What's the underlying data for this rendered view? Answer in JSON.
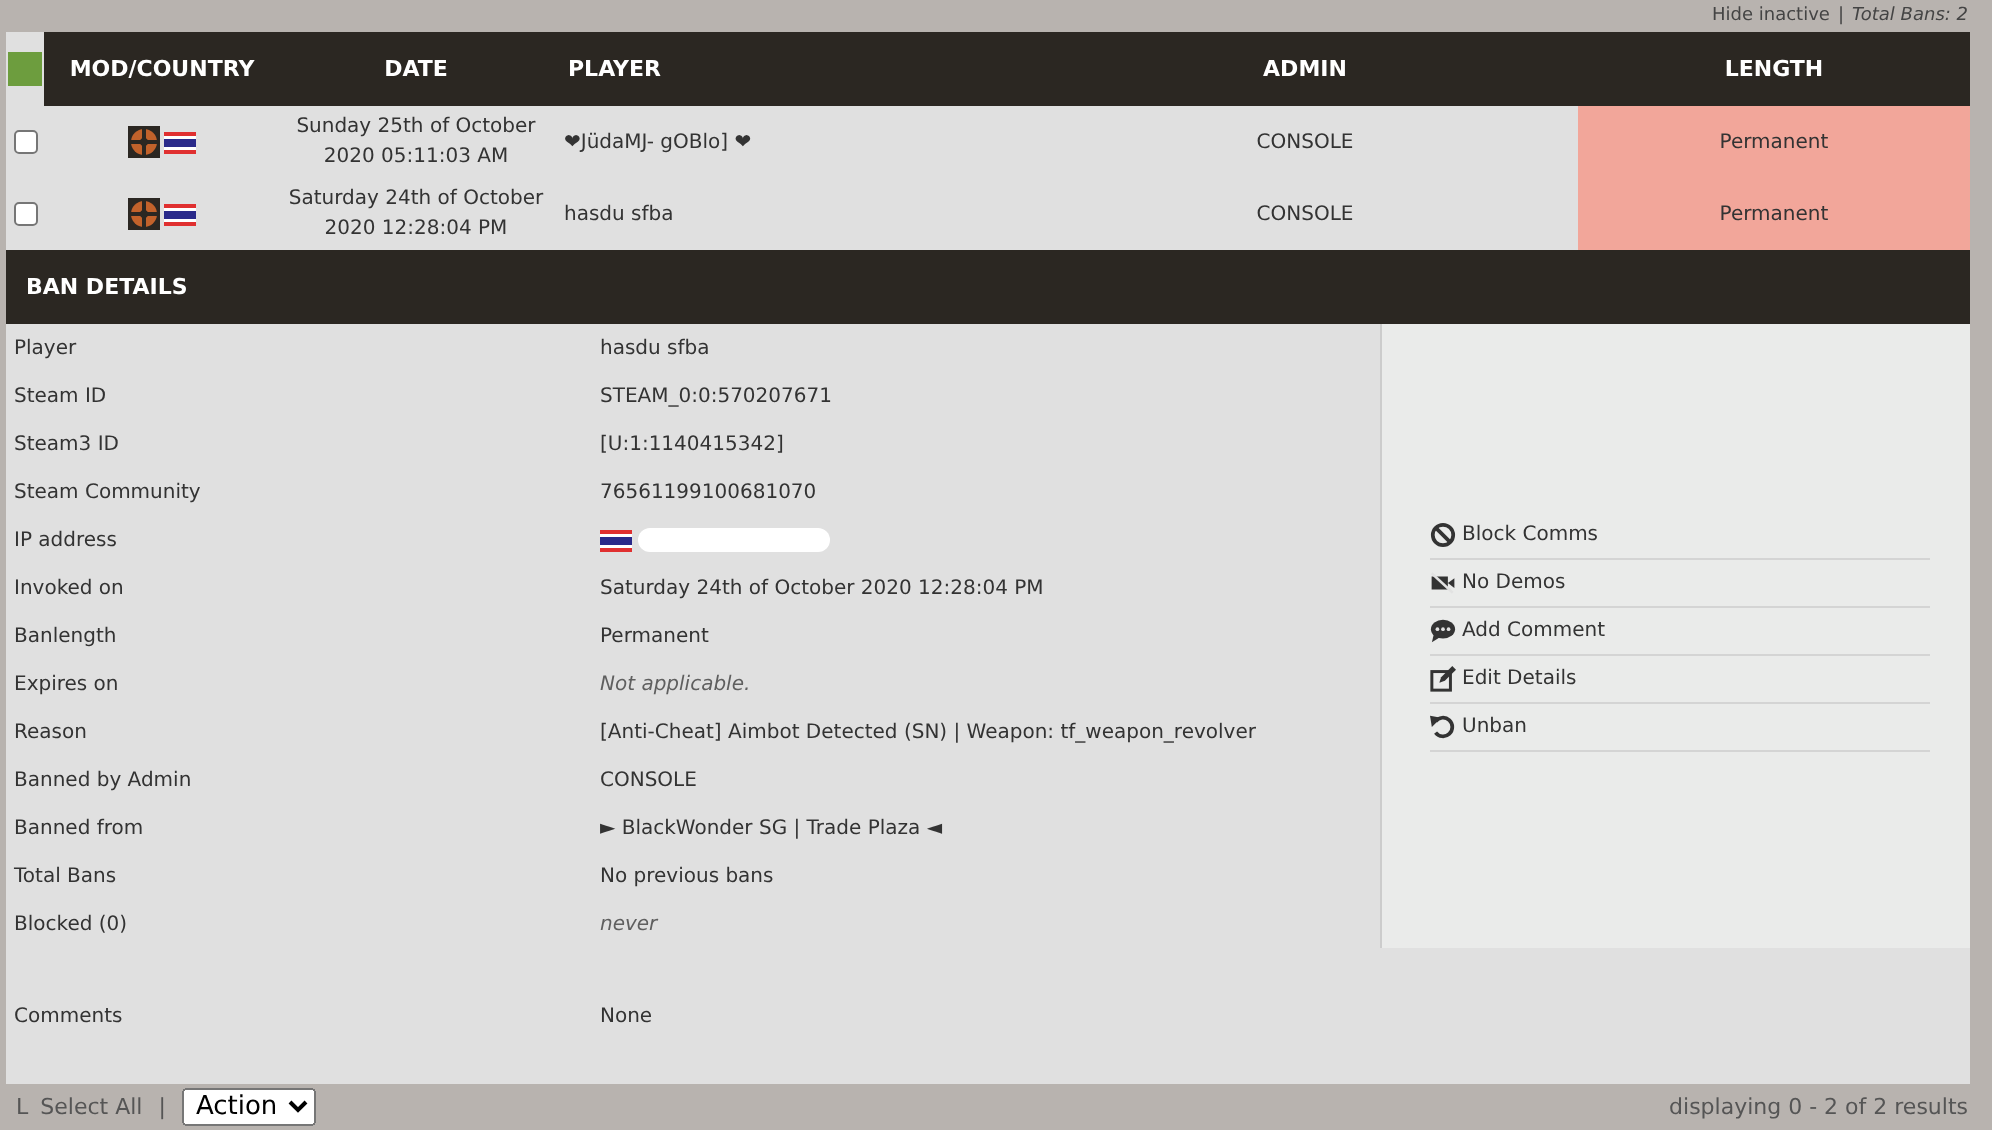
{
  "top_bar": {
    "hide_link": "Hide inactive",
    "separator": "|",
    "total": "Total Bans: 2"
  },
  "table": {
    "columns": [
      "MOD/COUNTRY",
      "DATE",
      "PLAYER",
      "ADMIN",
      "LENGTH"
    ],
    "rows": [
      {
        "checked": false,
        "date": "Sunday 25th of October\n2020 05:11:03 AM",
        "player": "❤JüdaMJ- gOBlo] ❤",
        "admin": "CONSOLE",
        "length": "Permanent"
      },
      {
        "checked": false,
        "date": "Saturday 24th of October\n2020 12:28:04 PM",
        "player": "hasdu sfba",
        "admin": "CONSOLE",
        "length": "Permanent"
      }
    ]
  },
  "ban_details": {
    "title": "BAN DETAILS",
    "fields": [
      {
        "kind": "text",
        "label": "Player",
        "value": "hasdu sfba"
      },
      {
        "kind": "text",
        "label": "Steam ID",
        "value": "STEAM_0:0:570207671"
      },
      {
        "kind": "text",
        "label": "Steam3 ID",
        "value": "[U:1:1140415342]"
      },
      {
        "kind": "text",
        "label": "Steam Community",
        "value": "76561199100681070"
      },
      {
        "kind": "ip",
        "label": "IP address"
      },
      {
        "kind": "text",
        "label": "Invoked on",
        "value": "Saturday 24th of October 2020 12:28:04 PM"
      },
      {
        "kind": "text",
        "label": "Banlength",
        "value": "Permanent"
      },
      {
        "kind": "muted",
        "label": "Expires on",
        "value": "Not applicable."
      },
      {
        "kind": "text",
        "label": "Reason",
        "value": "[Anti-Cheat] Aimbot Detected (SN) | Weapon: tf_weapon_revolver"
      },
      {
        "kind": "text",
        "label": "Banned by Admin",
        "value": "CONSOLE"
      },
      {
        "kind": "text",
        "label": "Banned from",
        "value": "► BlackWonder SG | Trade Plaza ◄"
      },
      {
        "kind": "text",
        "label": "Total Bans",
        "value": "No previous bans"
      },
      {
        "kind": "muted",
        "label": "Blocked (0)",
        "value": "never"
      },
      {
        "kind": "comment",
        "label": "Comments",
        "value": "None"
      }
    ],
    "actions": [
      {
        "kind": "block",
        "label": "Block Comms"
      },
      {
        "kind": "demos",
        "label": "No Demos"
      },
      {
        "kind": "comment",
        "label": "Add Comment"
      },
      {
        "kind": "edit",
        "label": "Edit Details"
      },
      {
        "kind": "unban",
        "label": "Unban"
      }
    ]
  },
  "footer": {
    "corner": "L",
    "select_all": "Select All",
    "separator": "|",
    "action": "Action",
    "results": "displaying 0 - 2 of 2 results"
  }
}
